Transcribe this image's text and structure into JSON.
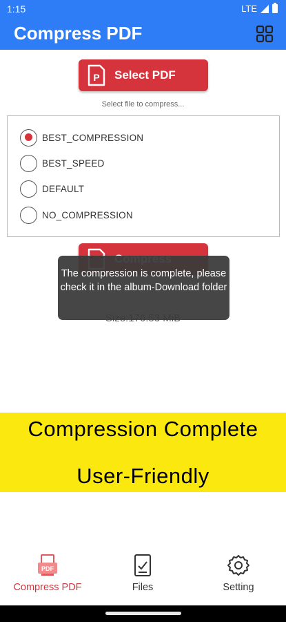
{
  "status_bar": {
    "time": "1:15",
    "network": "LTE"
  },
  "app_bar": {
    "title": "Compress PDF",
    "menu_icon": "grid-icon"
  },
  "select_button": {
    "label": "Select PDF",
    "icon": "pdf-file-icon"
  },
  "hint_text": "Select file to compress...",
  "options": [
    {
      "label": "BEST_COMPRESSION",
      "selected": true
    },
    {
      "label": "BEST_SPEED",
      "selected": false
    },
    {
      "label": "DEFAULT",
      "selected": false
    },
    {
      "label": "NO_COMPRESSION",
      "selected": false
    }
  ],
  "compress_button": {
    "label": "Compress",
    "icon": "compress-file-icon"
  },
  "size_text": "Size:176.53 MiB",
  "toast": {
    "message": "The compression is complete, please check it in the album-Download folder"
  },
  "banner": {
    "line1": "Compression Complete",
    "line2": "User-Friendly"
  },
  "bottom_nav": [
    {
      "label": "Compress PDF",
      "icon": "pdf-icon",
      "active": true
    },
    {
      "label": "Files",
      "icon": "file-check-icon",
      "active": false
    },
    {
      "label": "Setting",
      "icon": "gear-icon",
      "active": false
    }
  ],
  "colors": {
    "primary_blue": "#2f7df6",
    "accent_red": "#d5343c",
    "banner_yellow": "#fbe80f"
  }
}
